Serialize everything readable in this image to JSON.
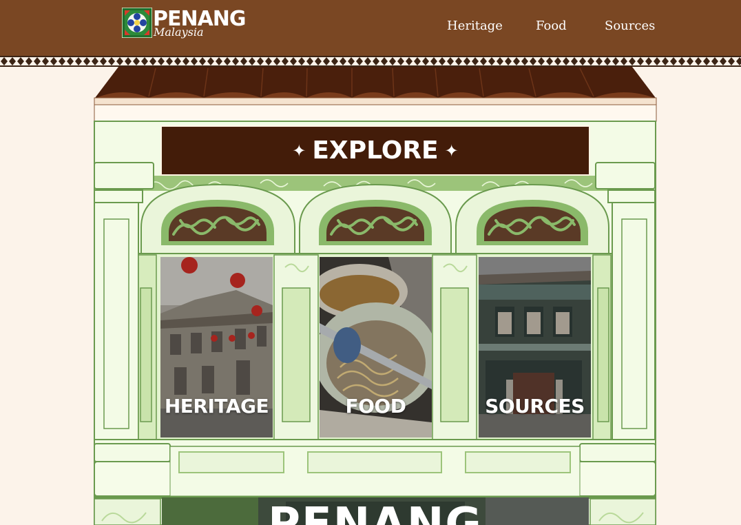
{
  "header": {
    "logo": {
      "title": "PENANG",
      "subtitle": "Malaysia",
      "icon": "batik-tile-icon"
    },
    "nav": [
      {
        "label": "Heritage"
      },
      {
        "label": "Food"
      },
      {
        "label": "Sources"
      }
    ]
  },
  "main": {
    "banner": {
      "title": "EXPLORE",
      "icon": "sparkle-icon"
    },
    "cards": [
      {
        "label": "HERITAGE",
        "image": "colonial-shophouse-with-red-lanterns"
      },
      {
        "label": "FOOD",
        "image": "bowl-of-noodles"
      },
      {
        "label": "SOURCES",
        "image": "green-peranakan-shophouse"
      }
    ],
    "hero": {
      "title": "PENANG"
    }
  },
  "colors": {
    "header_bg": "#7a4723",
    "page_bg": "#fcf3ea",
    "roof": "#4a1f0c",
    "banner_bg": "#431c09",
    "facade_light": "#f3fbe6",
    "facade_green": "#9cc47a",
    "facade_dark": "#6a9a4e"
  }
}
